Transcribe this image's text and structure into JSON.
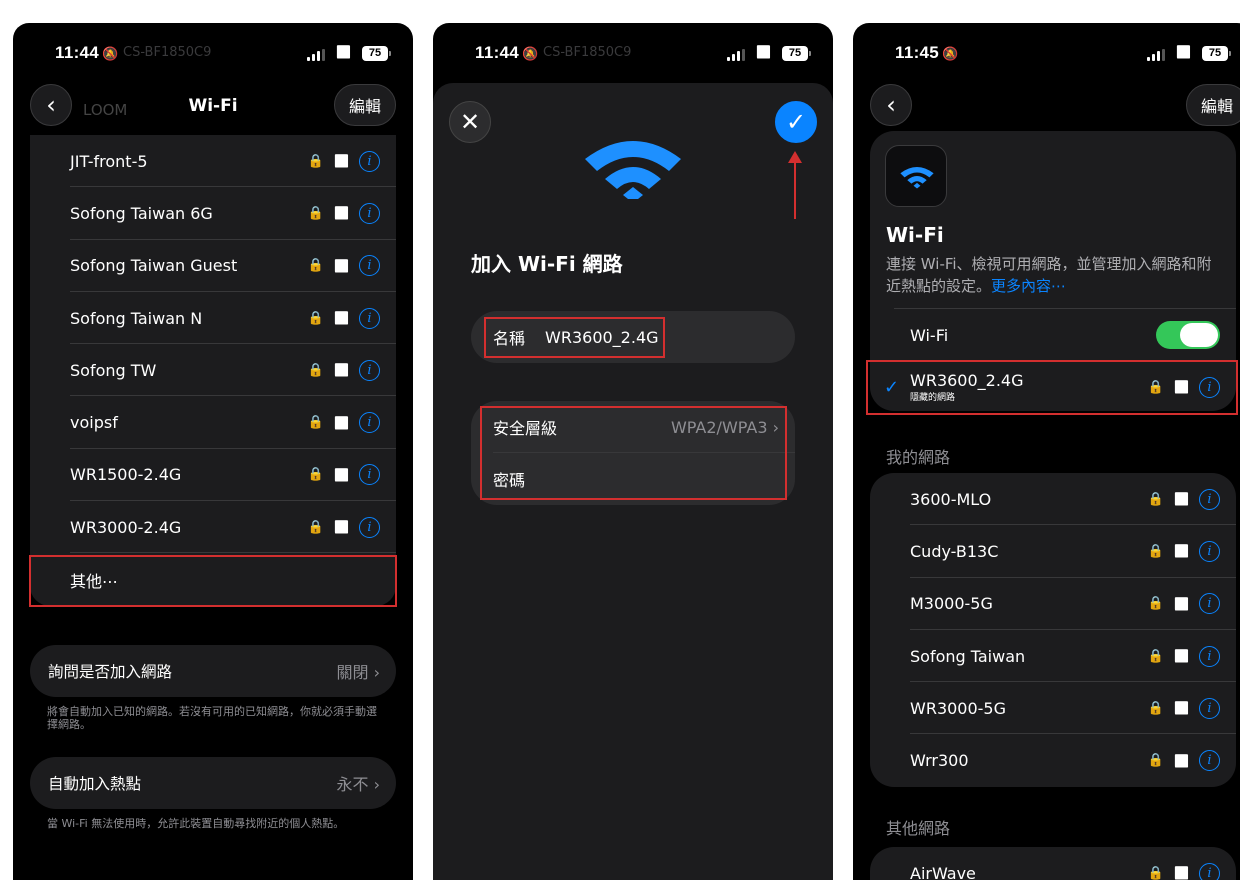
{
  "panel1": {
    "time": "11:44",
    "battery": "75",
    "ghost_top": "CS-BF1850C9",
    "ghost_row": "LOOM",
    "nav_title": "Wi-Fi",
    "edit_label": "編輯",
    "networks": [
      {
        "name": "JIT-front-5"
      },
      {
        "name": "Sofong Taiwan 6G"
      },
      {
        "name": "Sofong Taiwan Guest"
      },
      {
        "name": "Sofong Taiwan N"
      },
      {
        "name": "Sofong TW"
      },
      {
        "name": "voipsf"
      },
      {
        "name": "WR1500-2.4G"
      },
      {
        "name": "WR3000-2.4G"
      }
    ],
    "other_label": "其他⋯",
    "ask_join": {
      "label": "詢問是否加入網路",
      "value": "關閉"
    },
    "ask_join_note": "將會自動加入已知的網路。若沒有可用的已知網路，你就必須手動選擇網路。",
    "hotspot": {
      "label": "自動加入熱點",
      "value": "永不"
    },
    "hotspot_note": "當 Wi-Fi 無法使用時，允許此裝置自動尋找附近的個人熱點。"
  },
  "panel2": {
    "time": "11:44",
    "battery": "75",
    "ghost_top": "CS-BF1850C9",
    "title": "加入 Wi-Fi 網路",
    "name_label": "名稱",
    "name_value": "WR3600_2.4G",
    "security_label": "安全層級",
    "security_value": "WPA2/WPA3",
    "password_label": "密碼"
  },
  "panel3": {
    "time": "11:45",
    "battery": "75",
    "edit_label": "編輯",
    "title": "Wi-Fi",
    "desc": "連接 Wi-Fi、檢視可用網路，並管理加入網路和附近熱點的設定。",
    "more_link": "更多內容⋯",
    "wifi_toggle_label": "Wi-Fi",
    "wifi_on": true,
    "connected": {
      "name": "WR3600_2.4G",
      "sub": "隱藏的網路"
    },
    "my_networks_header": "我的網路",
    "my_networks": [
      {
        "name": "3600-MLO"
      },
      {
        "name": "Cudy-B13C"
      },
      {
        "name": "M3000-5G"
      },
      {
        "name": "Sofong Taiwan"
      },
      {
        "name": "WR3000-5G"
      },
      {
        "name": "Wrr300"
      }
    ],
    "other_networks_header": "其他網路",
    "other_networks": [
      {
        "name": "AirWave"
      }
    ]
  },
  "colors": {
    "accent": "#0a84ff",
    "highlight_box": "#d32f2f",
    "toggle_on": "#34c759",
    "group_bg": "#1c1c1e"
  }
}
